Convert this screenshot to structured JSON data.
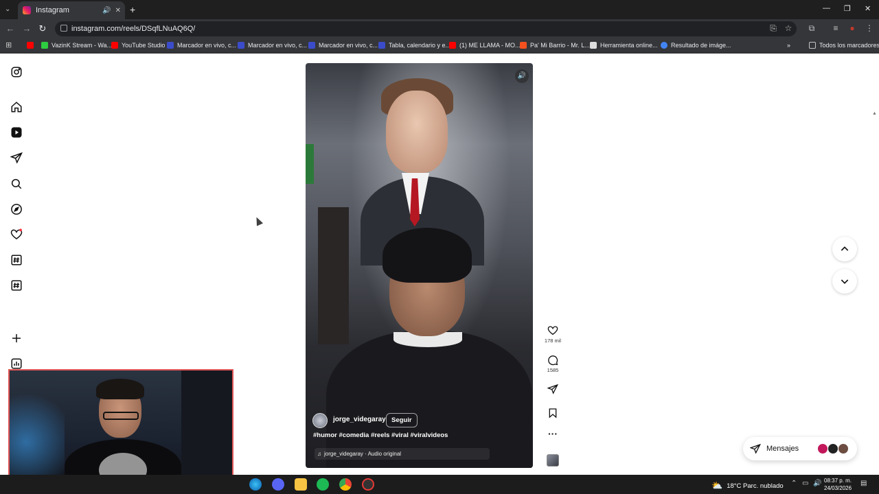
{
  "browser": {
    "tab_title": "Instagram",
    "url": "instagram.com/reels/DSqfLNuAQ6Q/",
    "bookmarks": [
      {
        "label": "VazinK Stream - Wa...",
        "color": "#2ecc40"
      },
      {
        "label": "YouTube Studio",
        "color": "#ff0000"
      },
      {
        "label": "Marcador en vivo, c...",
        "color": "#3b4cca"
      },
      {
        "label": "Marcador en vivo, c...",
        "color": "#3b4cca"
      },
      {
        "label": "Marcador en vivo, c...",
        "color": "#3b4cca"
      },
      {
        "label": "Tabla, calendario y e...",
        "color": "#3b4cca"
      },
      {
        "label": "(1) ME LLAMA - MO...",
        "color": "#ff0000"
      },
      {
        "label": "Pa' Mi Barrio - Mr. L...",
        "color": "#f4511e"
      },
      {
        "label": "Herramienta online...",
        "color": "#dddddd"
      },
      {
        "label": "Resultado de imáge...",
        "color": "#4285f4"
      }
    ],
    "all_bookmarks": "Todos los marcadores"
  },
  "sidebar": {
    "icons": [
      "instagram-icon",
      "home-icon",
      "reels-icon",
      "send-icon",
      "search-icon",
      "explore-icon",
      "heart-icon",
      "hashtag-icon",
      "hashtag-icon-2",
      "create-icon",
      "dashboard-icon"
    ]
  },
  "reel": {
    "username": "jorge_videgaray",
    "follow_label": "Seguir",
    "caption": "#humor #comedia #reels #viral #viralvideos",
    "audio": "jorge_videgaray · Audio original",
    "likes": "178 mil",
    "comments": "1585"
  },
  "messages": {
    "label": "Mensajes"
  },
  "taskbar": {
    "weather": "18°C  Parc. nublado",
    "time": "08:37 p. m.",
    "date": "24/03/2026"
  },
  "colors": {
    "accent_notification": "#ff3040",
    "webcam_border": "#e05555"
  }
}
